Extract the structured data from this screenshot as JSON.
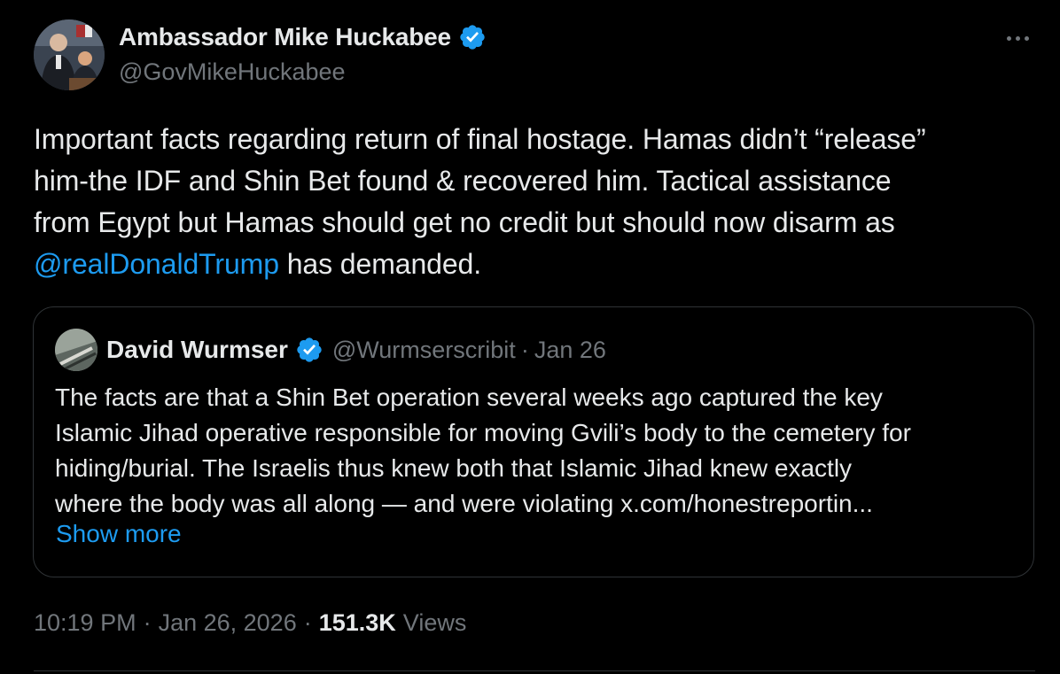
{
  "tweet": {
    "author": {
      "display_name": "Ambassador Mike Huckabee",
      "handle": "@GovMikeHuckabee",
      "verified_icon": "verified-badge-icon",
      "avatar_icon": "profile-photo"
    },
    "more_icon": "more-options-icon",
    "body_lines": [
      "Important facts regarding return of final hostage. Hamas didn’t “release”",
      "him-the IDF and Shin Bet found & recovered him. Tactical assistance",
      "from Egypt but Hamas should get no credit but should now disarm as"
    ],
    "mention": "@realDonaldTrump",
    "body_tail": " has demanded.",
    "quote": {
      "display_name": "David Wurmser",
      "handle": "@Wurmserscribit",
      "separator": "·",
      "date": "Jan 26",
      "text_lines": [
        "The facts are that a Shin Bet operation several weeks ago captured the key",
        "Islamic Jihad operative responsible for moving Gvili’s body to the cemetery for",
        "hiding/burial.  The Israelis thus knew both that Islamic Jihad knew exactly",
        "where the body was all along — and were violating x.com/honestreportin..."
      ],
      "show_more": "Show more"
    },
    "meta": {
      "time": "10:19 PM",
      "separator": "·",
      "date": "Jan 26, 2026",
      "views_count": "151.3K",
      "views_label": "Views"
    }
  },
  "colors": {
    "background": "#000000",
    "text_primary": "#e7e9ea",
    "text_secondary": "#71767b",
    "link": "#1d9bf0",
    "border": "#2f3336",
    "verified": "#1d9bf0"
  }
}
